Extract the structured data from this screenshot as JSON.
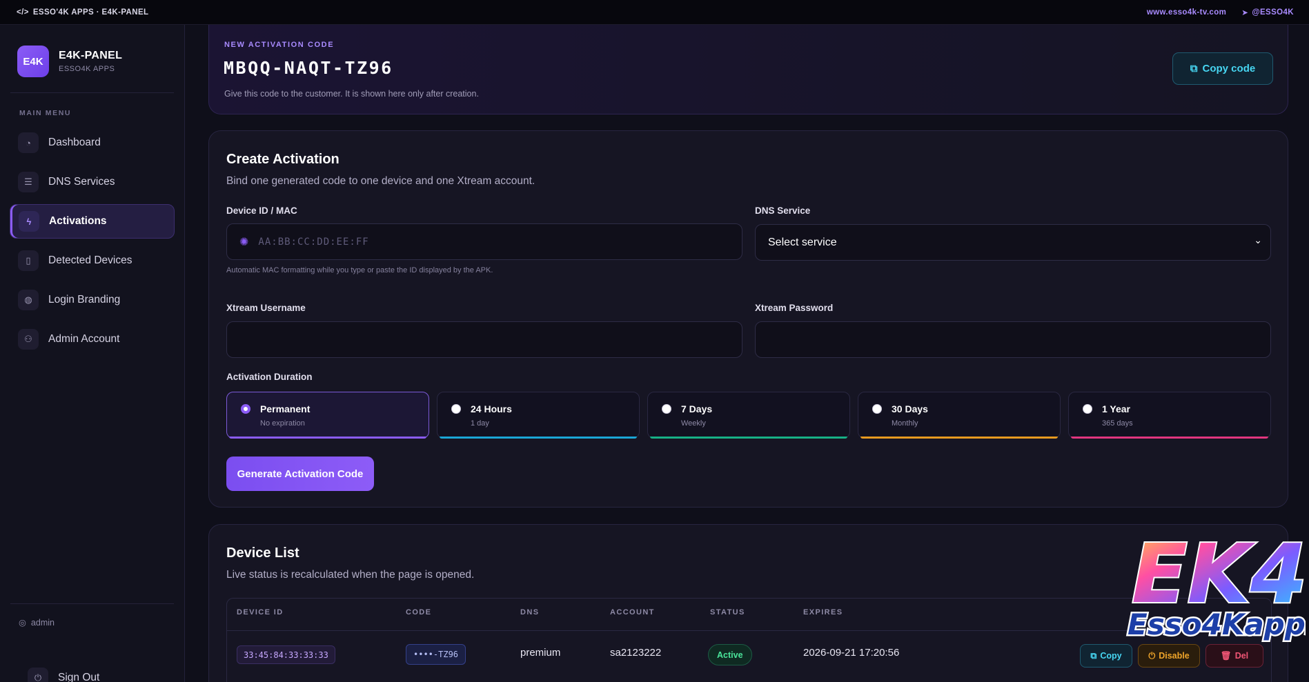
{
  "topbar": {
    "brand": "ESSO'4K APPS · E4K-PANEL",
    "site_link": "www.esso4k-tv.com",
    "telegram_link": "@ESSO4K"
  },
  "sidebar": {
    "logo_badge": "E4K",
    "logo_title": "E4K-PANEL",
    "logo_subtitle": "ESSO4K APPS",
    "menu_title": "MAIN MENU",
    "items": [
      {
        "label": "Dashboard",
        "icon": "gauge-icon"
      },
      {
        "label": "DNS Services",
        "icon": "server-list-icon"
      },
      {
        "label": "Activations",
        "icon": "bolt-icon"
      },
      {
        "label": "Detected Devices",
        "icon": "phone-icon"
      },
      {
        "label": "Login Branding",
        "icon": "palette-icon"
      },
      {
        "label": "Admin Account",
        "icon": "user-gear-icon"
      }
    ],
    "active_index": 2,
    "admin_user": "admin",
    "sign_out": "Sign Out"
  },
  "code_banner": {
    "label": "NEW ACTIVATION CODE",
    "code": "MBQQ-NAQT-TZ96",
    "hint": "Give this code to the customer. It is shown here only after creation.",
    "copy_button": "Copy code"
  },
  "create": {
    "title": "Create Activation",
    "subtitle": "Bind one generated code to one device and one Xtream account.",
    "device_label": "Device ID / MAC",
    "device_placeholder": "AA:BB:CC:DD:EE:FF",
    "device_help": "Automatic MAC formatting while you type or paste the ID displayed by the APK.",
    "dns_label": "DNS Service",
    "dns_value": "Select service",
    "username_label": "Xtream Username",
    "username_value": "",
    "password_label": "Xtream Password",
    "password_value": "",
    "duration_label": "Activation Duration",
    "durations": [
      {
        "title": "Permanent",
        "sub": "No expiration",
        "color": "#8b5cf6",
        "selected": true
      },
      {
        "title": "24 Hours",
        "sub": "1 day",
        "color": "#1aa6d6",
        "selected": false
      },
      {
        "title": "7 Days",
        "sub": "Weekly",
        "color": "#17b086",
        "selected": false
      },
      {
        "title": "30 Days",
        "sub": "Monthly",
        "color": "#e79a1f",
        "selected": false
      },
      {
        "title": "1 Year",
        "sub": "365 days",
        "color": "#e2367f",
        "selected": false
      }
    ],
    "generate_button": "Generate Activation Code"
  },
  "device_list": {
    "title": "Device List",
    "subtitle": "Live status is recalculated when the page is opened.",
    "columns": [
      "DEVICE ID",
      "CODE",
      "DNS",
      "ACCOUNT",
      "STATUS",
      "EXPIRES"
    ],
    "rows": [
      {
        "device_id": "33:45:84:33:33:33",
        "code": "••••-TZ96",
        "dns": "premium",
        "account": "sa2123222",
        "status": "Active",
        "expires": "2026-09-21 17:20:56",
        "actions": [
          "Copy",
          "Disable",
          "Del"
        ]
      }
    ]
  },
  "watermark": {
    "top_text": "EK4",
    "bottom_text": "Esso4Kapps"
  },
  "colors": {
    "accent": "#8b5cf6",
    "cyan": "#47d6f2",
    "success": "#4ae49a",
    "warning": "#f0a52a",
    "danger": "#f05575"
  }
}
